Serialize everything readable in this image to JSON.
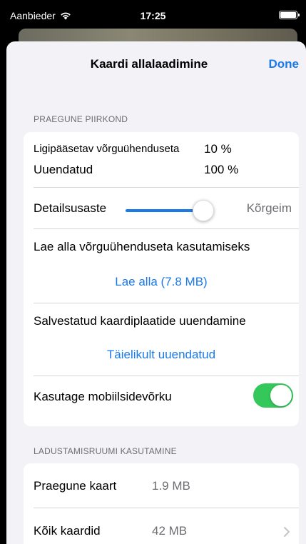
{
  "status_bar": {
    "carrier": "Aanbieder",
    "time": "17:25"
  },
  "nav": {
    "title": "Kaardi allalaadimine",
    "done": "Done"
  },
  "current_region": {
    "header": "PRAEGUNE PIIRKOND",
    "offline_label": "Ligipääsetav võrguühenduseta",
    "offline_value": "10 %",
    "updated_label": "Uuendatud",
    "updated_value": "100 %",
    "detail_label": "Detailsusaste",
    "detail_value": "Kõrgeim",
    "detail_level": 1.0,
    "download_label": "Lae alla võrguühenduseta kasutamiseks",
    "download_action": "Lae alla (7.8 MB)",
    "update_label": "Salvestatud kaardiplaatide uuendamine",
    "update_status": "Täielikult uuendatud",
    "mobile_label": "Kasutage mobiilsidevõrku",
    "mobile_enabled": true,
    "toggle_color": "#34c759",
    "accent_color": "#1a7ae8"
  },
  "storage": {
    "header": "LADUSTAMISRUUMI KASUTAMINE",
    "current_map_label": "Praegune kaart",
    "current_map_value": "1.9 MB",
    "all_maps_label": "Kõik kaardid",
    "all_maps_value": "42 MB"
  }
}
